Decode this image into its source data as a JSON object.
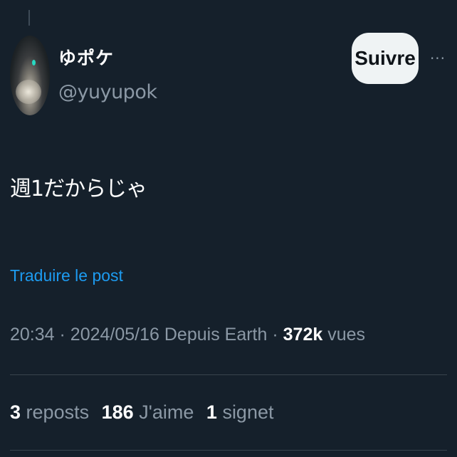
{
  "author": {
    "display_name": "ゆポケ",
    "handle": "@yuyupok"
  },
  "actions": {
    "follow_label": "Suivre",
    "more_label": "···"
  },
  "tweet": {
    "text": "週1だからじゃ",
    "translate_label": "Traduire le post"
  },
  "meta": {
    "time": "20:34",
    "date": "2024/05/16",
    "source": "Depuis Earth",
    "views_count": "372k",
    "views_label": "vues",
    "separator": "·"
  },
  "stats": {
    "reposts_count": "3",
    "reposts_label": "reposts",
    "likes_count": "186",
    "likes_label": "J'aime",
    "bookmarks_count": "1",
    "bookmarks_label": "signet"
  },
  "colors": {
    "background": "#15202b",
    "link": "#1d9bf0",
    "muted": "#8b98a5",
    "divider": "#38444d"
  }
}
